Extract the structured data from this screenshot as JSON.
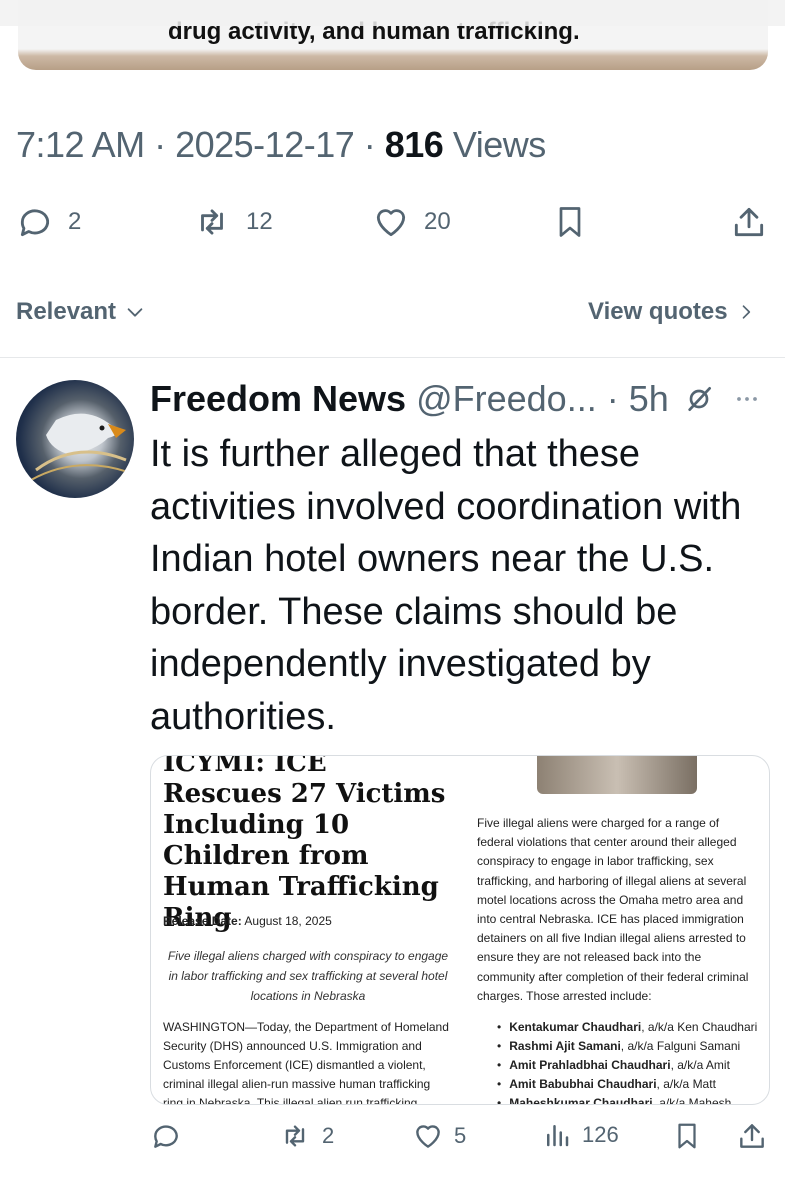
{
  "top_image": {
    "caption": "drug activity, and human trafficking."
  },
  "tweet_meta": {
    "time": "7:12 AM",
    "date": "2025-12-17",
    "views_count": "816",
    "views_label": "Views"
  },
  "tweet_actions": {
    "replies": "2",
    "reposts": "12",
    "likes": "20"
  },
  "sort_bar": {
    "sort_label": "Relevant",
    "view_quotes": "View quotes"
  },
  "reply": {
    "name": "Freedom News",
    "handle": "@Freedo...",
    "time": "5h",
    "text": "It is further alleged that these activities involved coordination with Indian hotel owners near the U.S. border. These claims should be independently investigated by authorities.",
    "card": {
      "headline": "ICYMI: ICE Rescues 27 Victims Including 10 Children from Human Trafficking Ring",
      "release_label": "Release Date:",
      "release_date": "August 18, 2025",
      "subhead": "Five illegal aliens charged with conspiracy to engage in labor trafficking and sex trafficking at several hotel locations in Nebraska",
      "paragraph1": "WASHINGTON—Today, the Department of Homeland Security (DHS) announced U.S. Immigration and Customs Enforcement (ICE) dismantled a violent, criminal illegal alien-run massive human trafficking ring in Nebraska. This illegal alien run trafficking",
      "paragraph2": "Five illegal aliens were charged for a range of federal violations that center around their alleged conspiracy to engage in labor trafficking, sex trafficking, and harboring of illegal aliens at several motel locations across the Omaha metro area and into central Nebraska. ICE has placed immigration detainers on all five Indian illegal aliens arrested to ensure they are not released back into the community after completion of their federal criminal charges. Those arrested include:",
      "arrested": [
        {
          "name": "Kentakumar Chaudhari",
          "alias": ", a/k/a Ken Chaudhari"
        },
        {
          "name": "Rashmi Ajit Samani",
          "alias": ", a/k/a Falguni Samani"
        },
        {
          "name": "Amit Prahladbhai Chaudhari",
          "alias": ", a/k/a Amit"
        },
        {
          "name": "Amit Babubhai Chaudhari",
          "alias": ", a/k/a Matt"
        },
        {
          "name": "Maheshkumar Chaudhari",
          "alias": ", a/k/a Mahesh"
        }
      ]
    },
    "actions": {
      "replies": "",
      "reposts": "2",
      "likes": "5",
      "views": "126"
    }
  },
  "colors": {
    "text": "#0f1419",
    "secondary": "#536471",
    "divider": "#e6e8ea"
  }
}
